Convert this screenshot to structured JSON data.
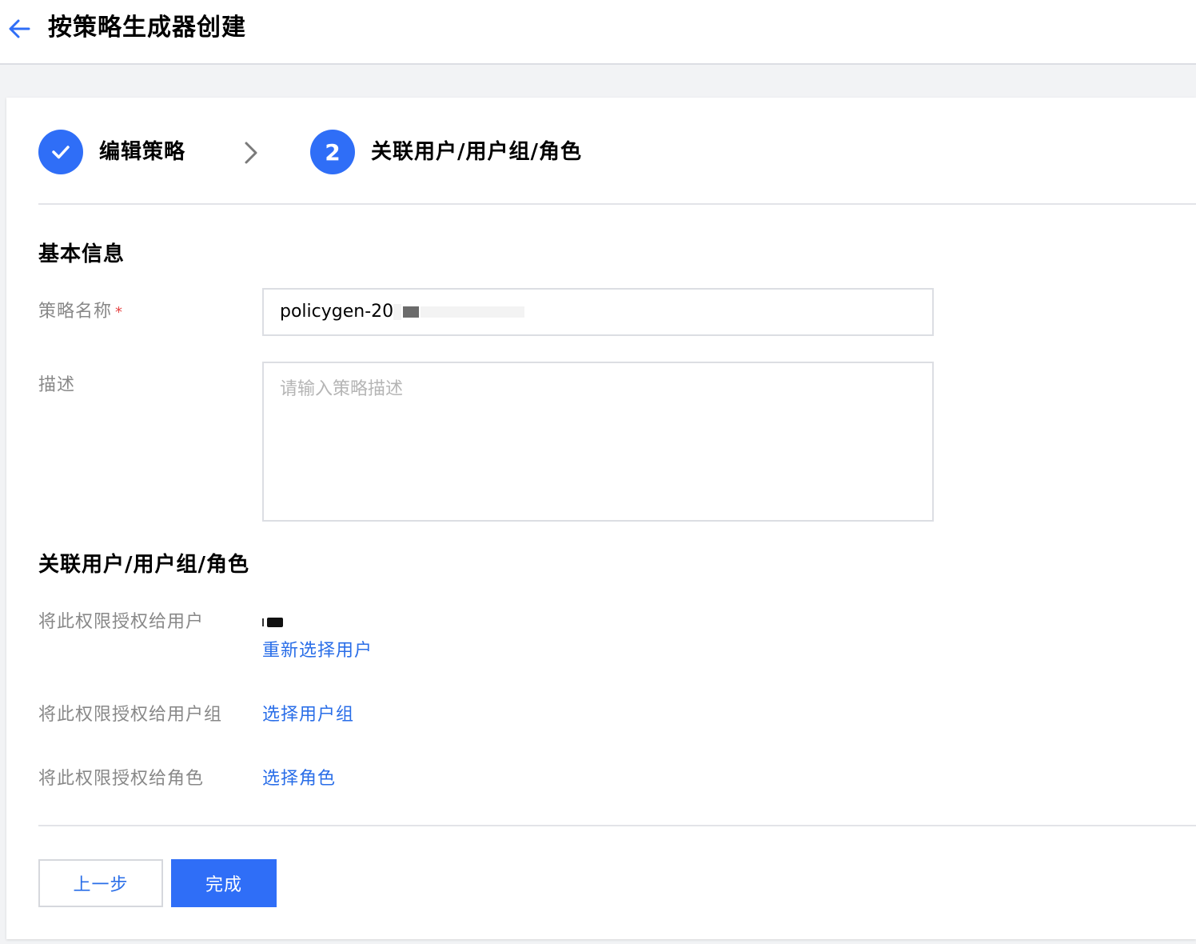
{
  "header": {
    "title": "按策略生成器创建",
    "back_icon": "arrow-left-icon"
  },
  "steps": [
    {
      "label": "编辑策略",
      "status": "completed",
      "icon": "check-icon"
    },
    {
      "label": "关联用户/用户组/角色",
      "status": "active",
      "number": "2"
    }
  ],
  "basic_info": {
    "title": "基本信息",
    "policy_name_label": "策略名称",
    "required_mark": "*",
    "policy_name_value": "policygen-20",
    "description_label": "描述",
    "description_placeholder": "请输入策略描述"
  },
  "association": {
    "title": "关联用户/用户组/角色",
    "grant_user_label": "将此权限授权给用户",
    "reselect_user_link": "重新选择用户",
    "grant_group_label": "将此权限授权给用户组",
    "select_group_link": "选择用户组",
    "grant_role_label": "将此权限授权给角色",
    "select_role_link": "选择角色"
  },
  "footer": {
    "prev_button": "上一步",
    "finish_button": "完成"
  },
  "colors": {
    "primary": "#2f6ef7",
    "link": "#2a6ee8",
    "required": "#e54545",
    "label": "#888888"
  }
}
